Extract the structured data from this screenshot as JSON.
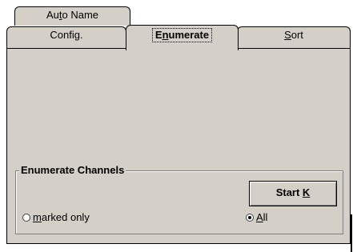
{
  "tabs": {
    "back_row": [
      {
        "label_pre": "Au",
        "label_u": "t",
        "label_post": "o Name"
      }
    ],
    "front_row": [
      {
        "label_pre": "Confi",
        "label_u": "g",
        "label_post": "."
      },
      {
        "label_pre": "E",
        "label_u": "n",
        "label_post": "umerate",
        "active": true
      },
      {
        "label_pre": "",
        "label_u": "S",
        "label_post": "ort"
      }
    ]
  },
  "group": {
    "title": "Enumerate Channels",
    "start_button": {
      "label_pre": "Start ",
      "label_u": "K",
      "label_post": ""
    },
    "radio_marked": {
      "label_pre": "",
      "label_u": "m",
      "label_post": "arked only",
      "selected": false
    },
    "radio_all": {
      "label_pre": "",
      "label_u": "A",
      "label_post": "ll",
      "selected": true
    }
  }
}
